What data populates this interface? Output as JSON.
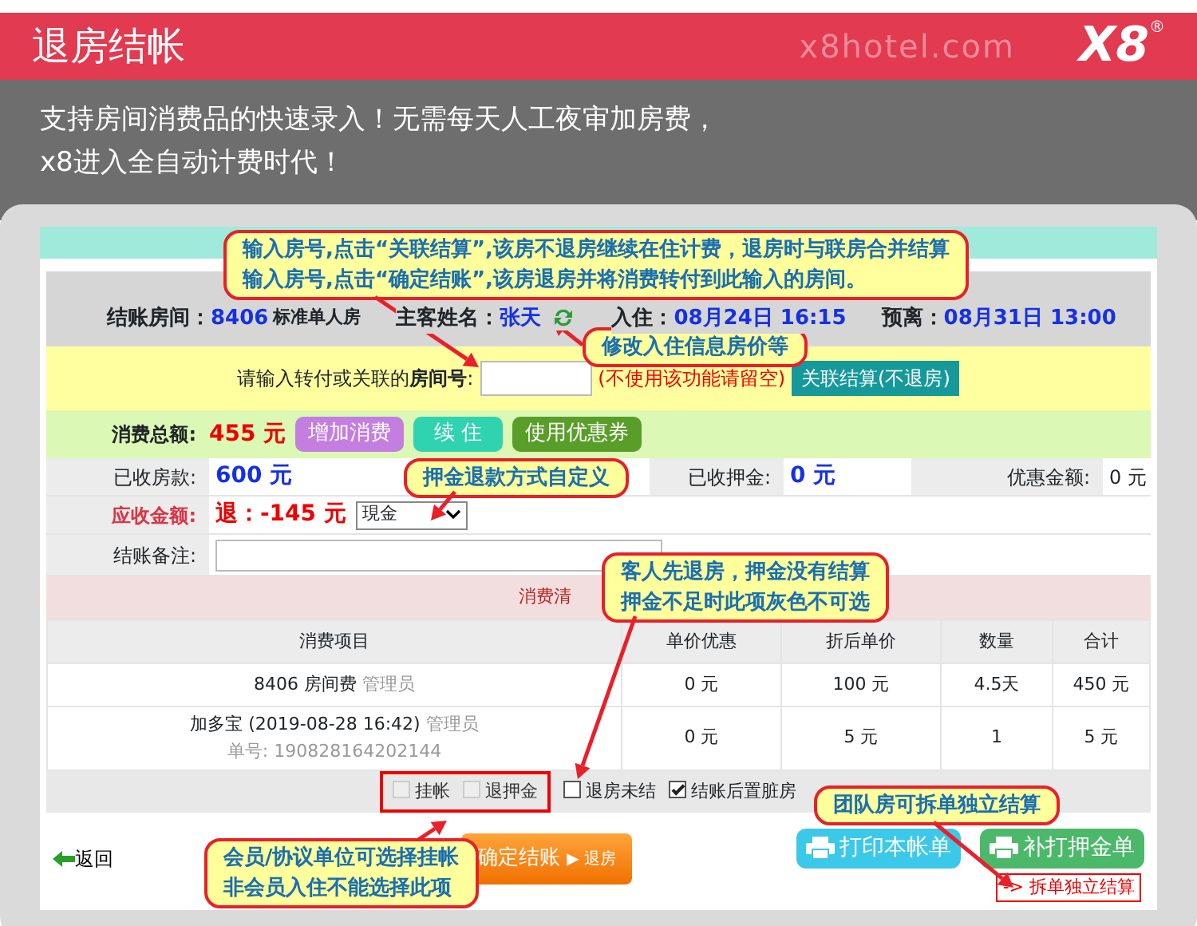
{
  "header": {
    "title": "退房结帐",
    "site": "x8hotel.com",
    "logo": "X8",
    "logo_mark": "®"
  },
  "intro": [
    "支持房间消费品的快速录入！无需每天人工夜审加房费，",
    "x8进入全自动计费时代！"
  ],
  "summary": [
    {
      "label": "结账房间：",
      "value": "8406",
      "note": "标准单人房"
    },
    {
      "label": "主客姓名：",
      "value": "张天",
      "edit_icon": true
    },
    {
      "label": "入住：",
      "value": "08月24日 16:15"
    },
    {
      "label": "预离：",
      "value": "08月31日 13:00"
    }
  ],
  "transfer": {
    "label": "请输入转付或关联的**房间号**:",
    "hint": "(不使用该功能请留空)",
    "button": "关联结算(不退房)"
  },
  "total": {
    "label": "消费总额:",
    "value": "455 元",
    "buttons": [
      {
        "label": "增加消费",
        "color": "#c47ee0"
      },
      {
        "label": "续 住",
        "color": "#2fd3b0"
      },
      {
        "label": "使用优惠券",
        "color": "#5a9e2a"
      }
    ]
  },
  "paid": [
    {
      "label": "已收房款:",
      "value": "600 元"
    },
    {
      "label": "已收押金:",
      "value": "0 元"
    },
    {
      "label": "优惠金额:",
      "value": "0 元"
    }
  ],
  "due": {
    "label": "应收金额:",
    "value": "退：-145 元",
    "method": "現金"
  },
  "remark": {
    "label": "结账备注:"
  },
  "list_title": "消费清",
  "columns": [
    "消费项目",
    "单价优惠",
    "折后单价",
    "数量",
    "合计"
  ],
  "rows": [
    {
      "item": "8406 房间费",
      "operator": "管理员",
      "discount": "0 元",
      "price": "100 元",
      "qty": "4.5天",
      "total": "450 元"
    },
    {
      "item": "加多宝 (2019-08-28 16:42)",
      "operator": "管理员",
      "order_no": "单号: 190828164202144",
      "discount": "0 元",
      "price": "5 元",
      "qty": "1",
      "total": "5 元"
    }
  ],
  "options": [
    {
      "label": "挂帐",
      "checked": false,
      "disabled": true
    },
    {
      "label": "退押金",
      "checked": false,
      "disabled": true
    },
    {
      "label": "退房未结",
      "checked": false,
      "disabled": false
    },
    {
      "label": "结账后置脏房",
      "checked": true,
      "disabled": false
    }
  ],
  "footer": {
    "back": "返回",
    "confirm": "确定结账",
    "confirm_sub": "▶ 退房",
    "print": [
      {
        "label": "打印本帐单",
        "color": "#3cc8e8"
      },
      {
        "label": "补打押金单",
        "color": "#4cb86a"
      }
    ],
    "split": "-> 拆单独立结算"
  },
  "callouts": [
    {
      "lines": [
        "输入房号,点击“关联结算”,该房不退房继续在住计费，退房时与联房合并结算",
        "输入房号,点击“确定结账”,该房退房并将消费转付到此输入的房间。"
      ]
    },
    {
      "lines": [
        "修改入住信息房价等"
      ]
    },
    {
      "lines": [
        "押金退款方式自定义"
      ]
    },
    {
      "lines": [
        "客人先退房，押金没有结算",
        "押金不足时此项灰色不可选"
      ]
    },
    {
      "lines": [
        "会员/协议单位可选择挂帐",
        "非会员入住不能选择此项"
      ]
    },
    {
      "lines": [
        "团队房可拆单独立结算"
      ]
    }
  ]
}
